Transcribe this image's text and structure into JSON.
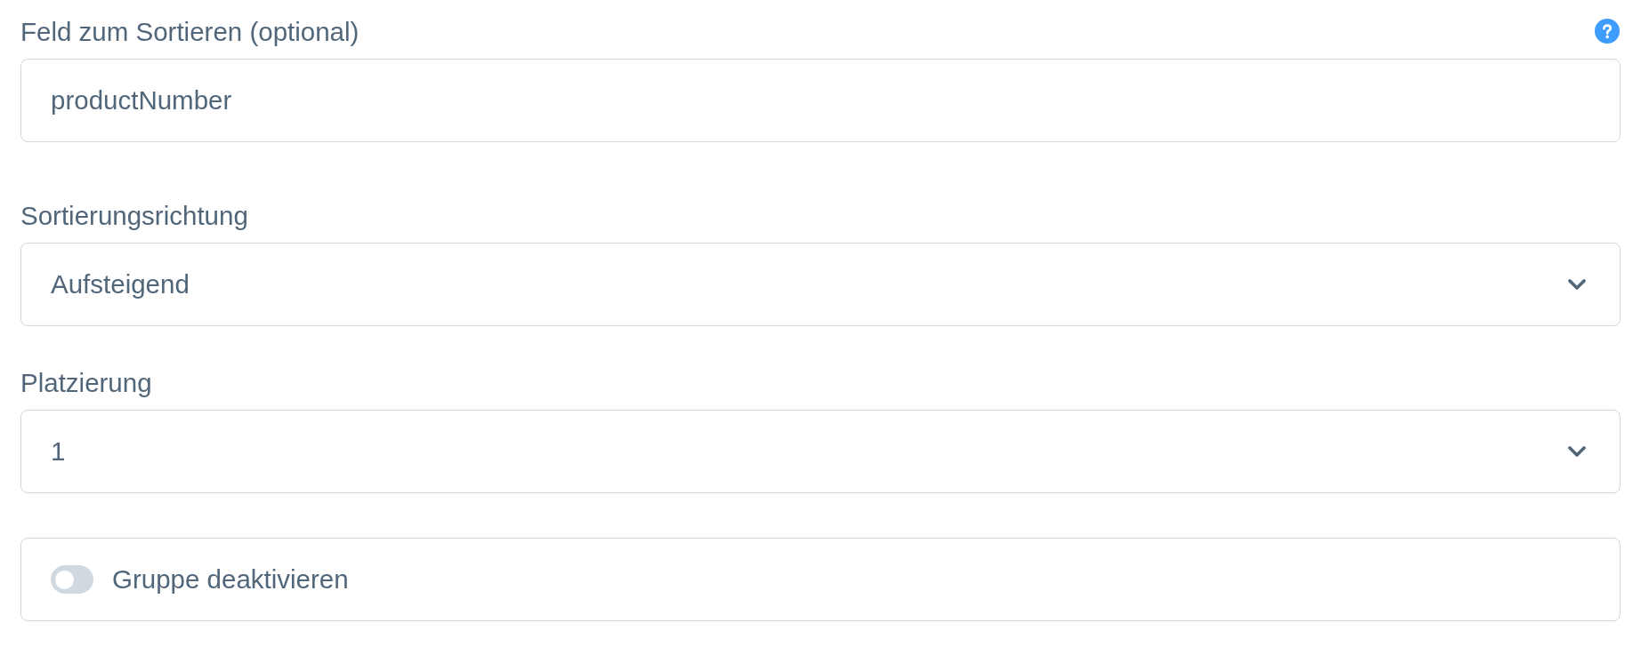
{
  "fields": [
    {
      "kind": "text",
      "label": "Feld zum Sortieren (optional)",
      "help": true,
      "value": "productNumber"
    },
    {
      "kind": "select",
      "label": "Sortierungsrichtung",
      "value": "Aufsteigend"
    },
    {
      "kind": "select",
      "label": "Platzierung",
      "value": "1"
    },
    {
      "kind": "switch",
      "label": "Gruppe deaktivieren",
      "on": false
    }
  ]
}
